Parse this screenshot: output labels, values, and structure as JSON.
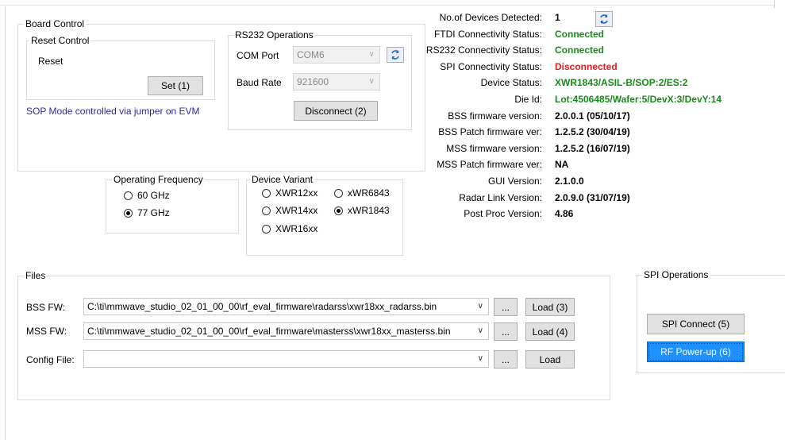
{
  "board_control": {
    "title": "Board Control",
    "reset_control": {
      "title": "Reset Control",
      "reset_label": "Reset",
      "set_button": "Set (1)"
    },
    "sop_note": "SOP Mode controlled via jumper on EVM",
    "rs232": {
      "title": "RS232 Operations",
      "com_port_label": "COM Port",
      "com_port_value": "COM6",
      "baud_rate_label": "Baud Rate",
      "baud_rate_value": "921600",
      "disconnect_button": "Disconnect (2)"
    }
  },
  "operating_frequency": {
    "title": "Operating Frequency",
    "options": [
      {
        "label": "60 GHz",
        "selected": false
      },
      {
        "label": "77 GHz",
        "selected": true
      }
    ]
  },
  "device_variant": {
    "title": "Device Variant",
    "options": [
      {
        "label": "XWR12xx",
        "selected": false
      },
      {
        "label": "xWR6843",
        "selected": false
      },
      {
        "label": "XWR14xx",
        "selected": false
      },
      {
        "label": "xWR1843",
        "selected": true
      },
      {
        "label": "XWR16xx",
        "selected": false
      }
    ]
  },
  "status": {
    "rows": [
      {
        "label": "No.of Devices Detected:",
        "value": "1",
        "color": "#000000"
      },
      {
        "label": "FTDI Connectivity Status:",
        "value": "Connected",
        "color": "#1a8a1a"
      },
      {
        "label": "RS232 Connectivity Status:",
        "value": "Connected",
        "color": "#1a8a1a"
      },
      {
        "label": "SPI Connectivity Status:",
        "value": "Disconnected",
        "color": "#e02020"
      },
      {
        "label": "Device Status:",
        "value": "XWR1843/ASIL-B/SOP:2/ES:2",
        "color": "#1a8a1a"
      },
      {
        "label": "Die Id:",
        "value": "Lot:4506485/Wafer:5/DevX:3/DevY:14",
        "color": "#1a8a1a"
      },
      {
        "label": "BSS firmware version:",
        "value": "2.0.0.1 (05/10/17)",
        "color": "#000000"
      },
      {
        "label": "BSS Patch firmware ver:",
        "value": "1.2.5.2 (30/04/19)",
        "color": "#000000"
      },
      {
        "label": "MSS firmware version:",
        "value": "1.2.5.2 (16/07/19)",
        "color": "#000000"
      },
      {
        "label": "MSS Patch firmware ver:",
        "value": "NA",
        "color": "#000000"
      },
      {
        "label": "GUI Version:",
        "value": "2.1.0.0",
        "color": "#000000"
      },
      {
        "label": "Radar Link Version:",
        "value": "2.0.9.0 (31/07/19)",
        "color": "#000000"
      },
      {
        "label": "Post Proc Version:",
        "value": "4.86",
        "color": "#000000"
      }
    ]
  },
  "files": {
    "title": "Files",
    "rows": [
      {
        "label": "BSS FW:",
        "path": "C:\\ti\\mmwave_studio_02_01_00_00\\rf_eval_firmware\\radarss\\xwr18xx_radarss.bin",
        "browse": "...",
        "load": "Load (3)"
      },
      {
        "label": "MSS FW:",
        "path": "C:\\ti\\mmwave_studio_02_01_00_00\\rf_eval_firmware\\masterss\\xwr18xx_masterss.bin",
        "browse": "...",
        "load": "Load (4)"
      },
      {
        "label": "Config File:",
        "path": "",
        "browse": "...",
        "load": "Load"
      }
    ]
  },
  "spi_operations": {
    "title": "SPI Operations",
    "connect_button": "SPI Connect (5)",
    "rf_powerup_button": "RF Power-up (6)"
  },
  "colors": {
    "accent": "#1e90ff",
    "link_text": "#2a2aa0",
    "ok": "#1a8a1a",
    "error": "#e02020"
  }
}
